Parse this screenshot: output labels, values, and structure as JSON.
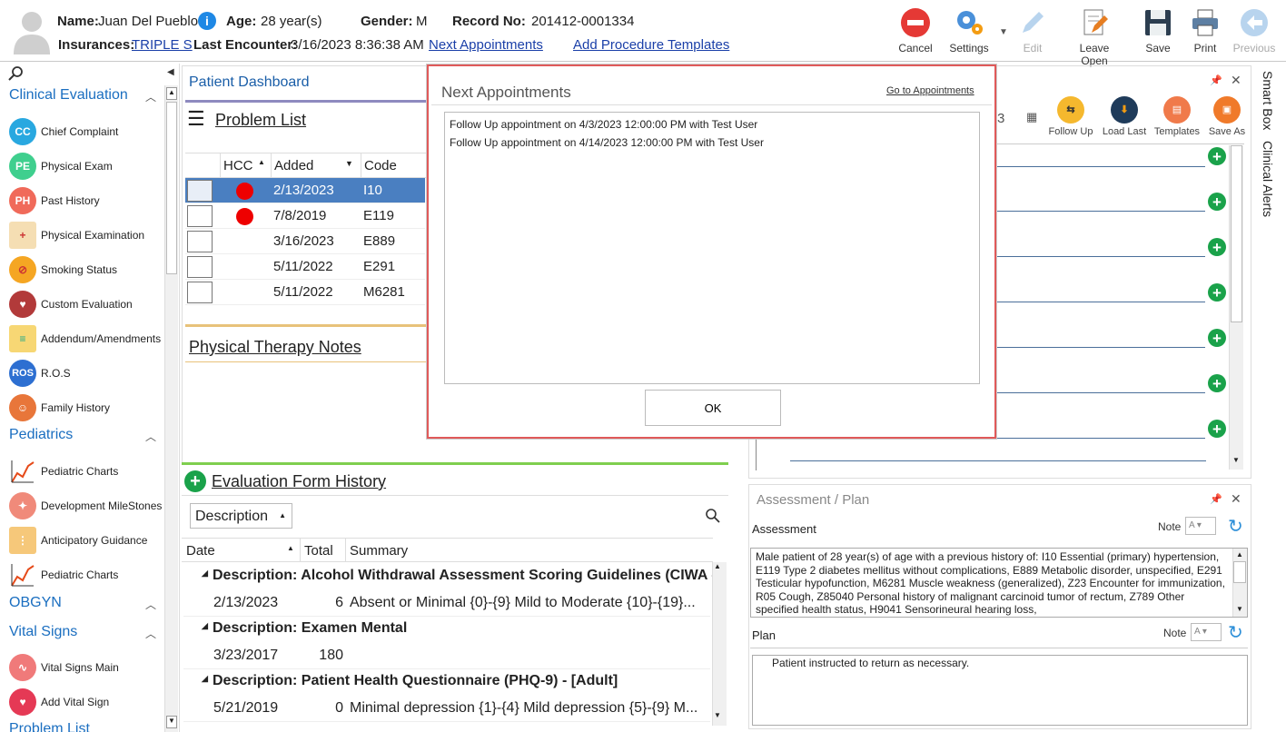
{
  "patient": {
    "name_label": "Name:",
    "name": "Juan Del Pueblo",
    "age_label": "Age:",
    "age": "28 year(s)",
    "gender_label": "Gender:",
    "gender": "M",
    "record_label": "Record No:",
    "record": "201412-0001334",
    "insurances_label": "Insurances:",
    "insurance": "TRIPLE S",
    "last_enc_label": "Last Encounter:",
    "last_enc": "3/16/2023 8:36:38 AM",
    "next_appt_link": "Next Appointments",
    "add_proc_link": "Add Procedure Templates"
  },
  "toolbar": {
    "cancel": "Cancel",
    "settings": "Settings",
    "edit": "Edit",
    "leave_open": "Leave Open",
    "save": "Save",
    "print": "Print",
    "previous": "Previous"
  },
  "sidebar": {
    "clinical": "Clinical Evaluation",
    "items": [
      "Chief Complaint",
      "Physical Exam",
      "Past History",
      "Physical Examination",
      "Smoking Status",
      "Custom Evaluation",
      "Addendum/Amendments",
      "R.O.S",
      "Family History"
    ],
    "pediatrics": "Pediatrics",
    "ped_items": [
      "Pediatric Charts",
      "Development MileStones",
      "Anticipatory Guidance",
      "Pediatric Charts"
    ],
    "obgyn": "OBGYN",
    "vitals": "Vital Signs",
    "vital_items": [
      "Vital Signs Main",
      "Add Vital Sign"
    ],
    "problem_list": "Problem List"
  },
  "dashboard": {
    "title": "Patient Dashboard",
    "problem_list": "Problem List",
    "cols": [
      "HCC",
      "Added",
      "Code"
    ],
    "rows": [
      {
        "date": "2/13/2023",
        "code": "I10",
        "hcc": true
      },
      {
        "date": "7/8/2019",
        "code": "E119",
        "hcc": true
      },
      {
        "date": "3/16/2023",
        "code": "E889",
        "hcc": false
      },
      {
        "date": "5/11/2022",
        "code": "E291",
        "hcc": false
      },
      {
        "date": "5/11/2022",
        "code": "M6281",
        "hcc": false
      }
    ],
    "pt_notes": "Physical Therapy Notes"
  },
  "right_tools": {
    "follow_up": "Follow Up",
    "load_last": "Load Last",
    "templates": "Templates",
    "save_as": "Save As"
  },
  "side_tabs": {
    "smart_box": "Smart Box",
    "clinical_alerts": "Clinical Alerts"
  },
  "history": {
    "title": "Evaluation Form History",
    "group_by": "Description",
    "cols": [
      "Date",
      "Total",
      "Summary"
    ],
    "groups": [
      {
        "desc": "Description: Alcohol Withdrawal Assessment Scoring Guidelines (CIWA - A",
        "date": "2/13/2023",
        "total": "6",
        "summary": "Absent or Minimal {0}-{9}  Mild to Moderate {10}-{19}..."
      },
      {
        "desc": "Description: Examen Mental",
        "date": "3/23/2017",
        "total": "180",
        "summary": ""
      },
      {
        "desc": "Description: Patient Health Questionnaire (PHQ-9) - [Adult]",
        "date": "5/21/2019",
        "total": "0",
        "summary": "Minimal depression {1}-{4}  Mild depression {5}-{9}  M..."
      }
    ]
  },
  "assessment": {
    "title": "Assessment / Plan",
    "assessment_label": "Assessment",
    "note": "Note",
    "text": "Male patient of 28 year(s) of age  with a previous history of: I10 Essential (primary) hypertension, E119 Type 2 diabetes mellitus without complications, E889 Metabolic disorder, unspecified, E291 Testicular hypofunction, M6281 Muscle weakness (generalized), Z23 Encounter for immunization, R05 Cough, Z85040 Personal history of malignant carcinoid tumor of rectum, Z789 Other specified health status, H9041 Sensorineural hearing loss,",
    "plan_label": "Plan",
    "plan_text": "Patient instructed to return as necessary."
  },
  "modal": {
    "title": "Next Appointments",
    "go_link": "Go to Appointments",
    "appointments": [
      "Follow Up appointment on 4/3/2023 12:00:00 PM with Test User",
      "Follow Up appointment on 4/14/2023 12:00:00 PM with Test User"
    ],
    "ok": "OK"
  },
  "colors": {
    "accent": "#1a5ea8",
    "selected_row": "#4a7fc1",
    "modal_border": "#e05a5a",
    "plus": "#1aa24a"
  }
}
